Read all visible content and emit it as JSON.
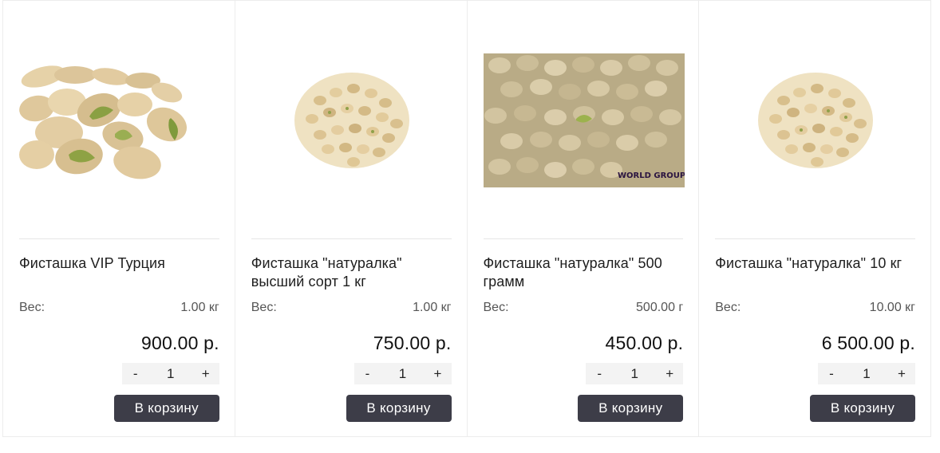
{
  "products": [
    {
      "title": "Фисташка VIP Турция",
      "weight_label": "Вес:",
      "weight_value": "1.00 кг",
      "price": "900.00 р.",
      "qty_minus": "-",
      "qty_value": "1",
      "qty_plus": "+",
      "cart_label": "В корзину",
      "image": "pistachio-closeup-image"
    },
    {
      "title": "Фисташка \"натуралка\" высший сорт 1 кг",
      "weight_label": "Вес:",
      "weight_value": "1.00 кг",
      "price": "750.00 р.",
      "qty_minus": "-",
      "qty_value": "1",
      "qty_plus": "+",
      "cart_label": "В корзину",
      "image": "pistachio-pile-image"
    },
    {
      "title": "Фисташка \"натуралка\" 500 грамм",
      "weight_label": "Вес:",
      "weight_value": "500.00 г",
      "price": "450.00 р.",
      "qty_minus": "-",
      "qty_value": "1",
      "qty_plus": "+",
      "cart_label": "В корзину",
      "image": "pistachio-full-frame-image",
      "watermark": "WORLD GROUP"
    },
    {
      "title": "Фисташка \"натуралка\" 10 кг",
      "weight_label": "Вес:",
      "weight_value": "10.00 кг",
      "price": "6 500.00 р.",
      "qty_minus": "-",
      "qty_value": "1",
      "qty_plus": "+",
      "cart_label": "В корзину",
      "image": "pistachio-pile-image"
    }
  ],
  "colors": {
    "cart_button": "#3d3d48",
    "qty_background": "#f3f3f3",
    "border": "#ececec",
    "nut_shell": "#d9c7a0",
    "nut_kernel": "#8fa04a"
  }
}
